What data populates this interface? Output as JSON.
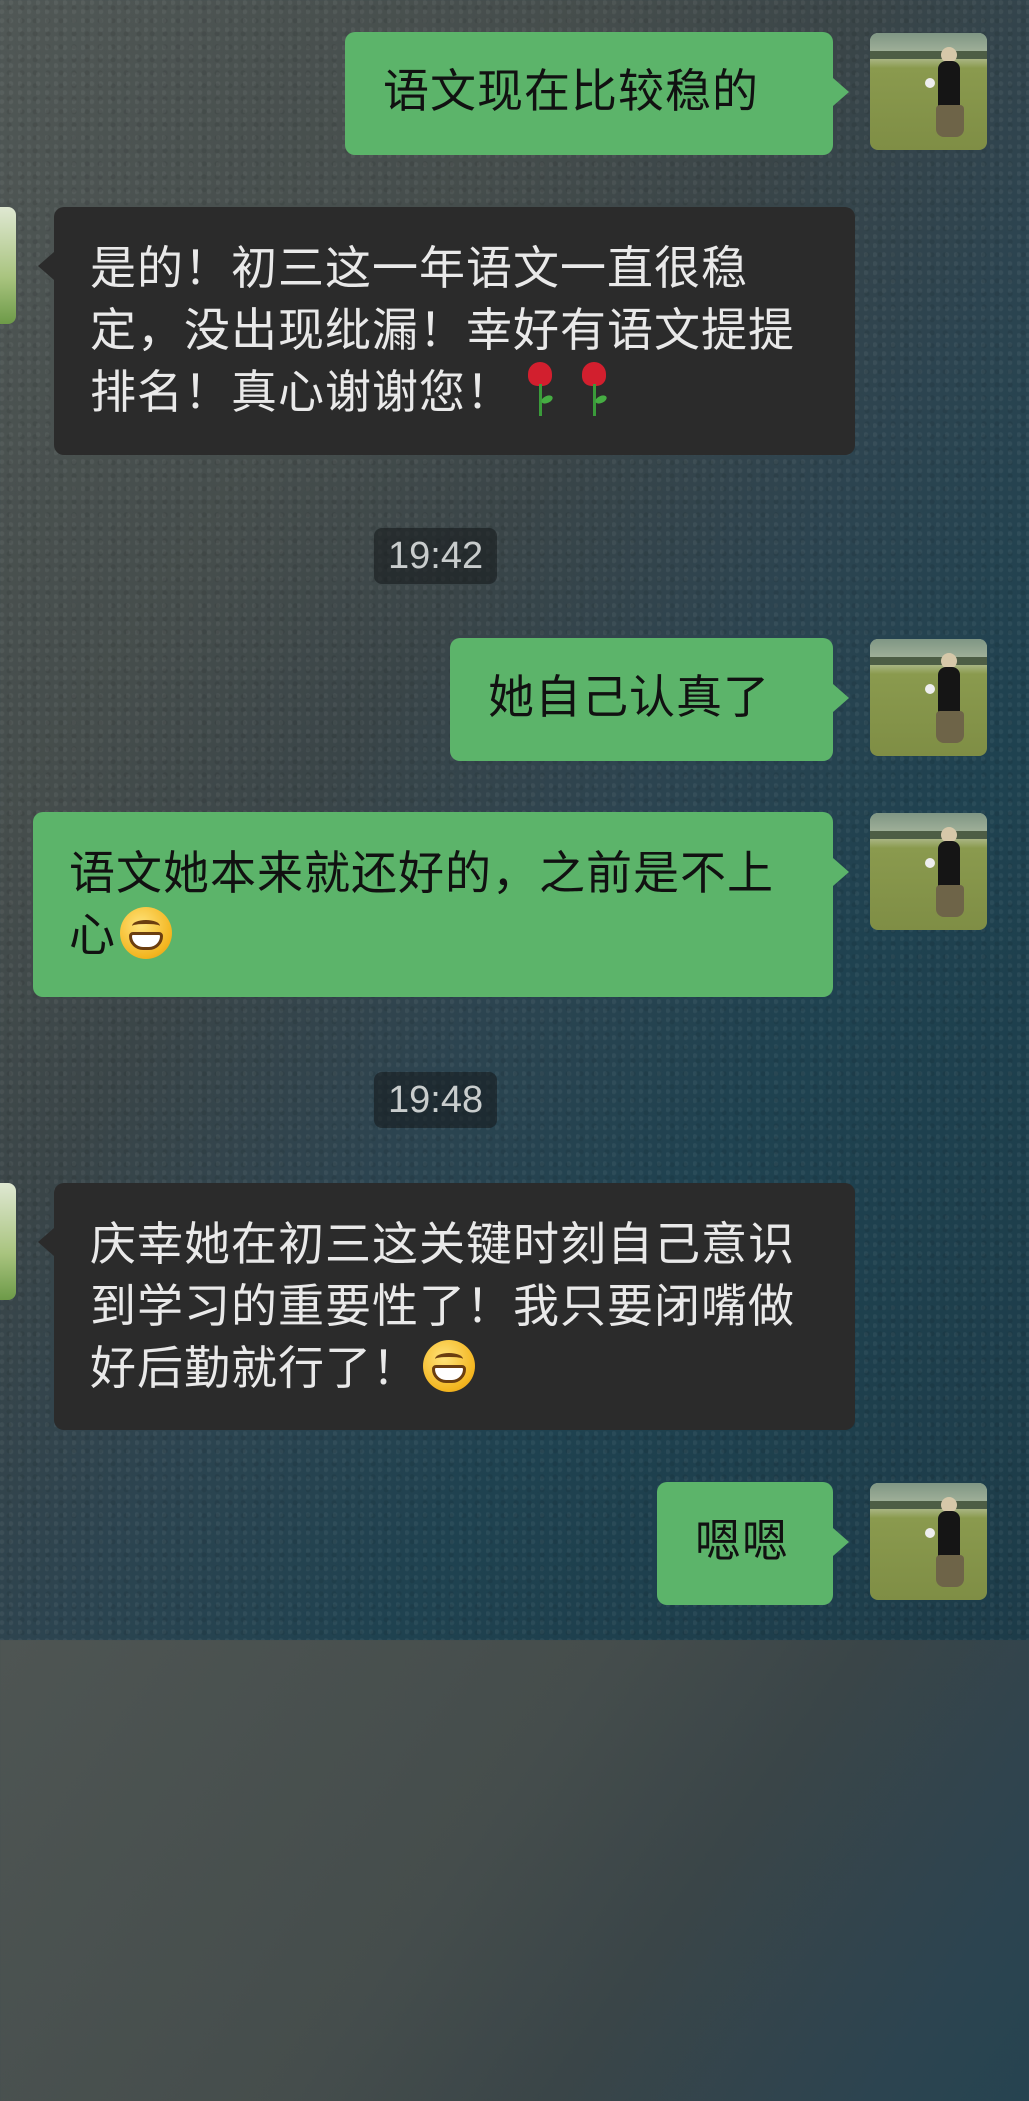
{
  "messages": [
    {
      "from": "me",
      "text": "语文现在比较稳的"
    },
    {
      "from": "them",
      "text": "是的！初三这一年语文一直很稳定，没出现纰漏！幸好有语文提提排名！真心谢谢您！",
      "emoji": [
        "rose-icon",
        "rose-icon"
      ]
    },
    {
      "type": "time",
      "text": "19:42"
    },
    {
      "from": "me",
      "text": "她自己认真了"
    },
    {
      "from": "me",
      "text": "语文她本来就还好的，之前是不上心",
      "emoji": [
        "grin-icon"
      ]
    },
    {
      "type": "time",
      "text": "19:48"
    },
    {
      "from": "them",
      "text": "庆幸她在初三这关键时刻自己意识到学习的重要性了！我只要闭嘴做好后勤就行了！",
      "emoji": [
        "grin-icon"
      ]
    },
    {
      "from": "me",
      "text": "嗯嗯"
    }
  ],
  "colors": {
    "my_bubble": "#5cb46a",
    "their_bubble": "#2b2b2b",
    "time_badge": "#14181a"
  }
}
